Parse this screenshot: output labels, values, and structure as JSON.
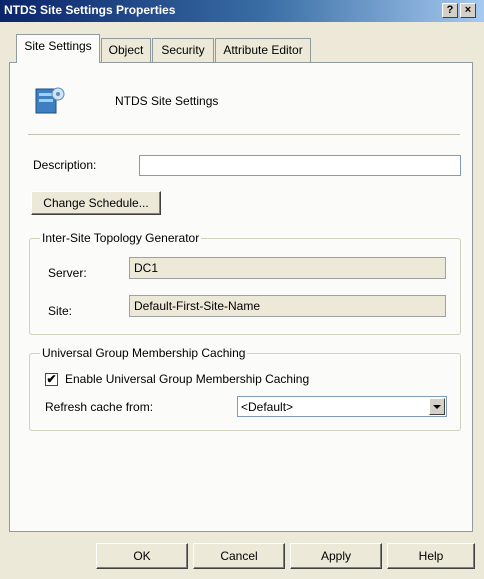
{
  "window": {
    "title": "NTDS Site Settings Properties",
    "help_label": "?",
    "close_label": "×"
  },
  "tabs": [
    {
      "label": "Site Settings",
      "active": true
    },
    {
      "label": "Object",
      "active": false
    },
    {
      "label": "Security",
      "active": false
    },
    {
      "label": "Attribute Editor",
      "active": false
    }
  ],
  "header": {
    "object_name": "NTDS Site Settings",
    "icon": "ntds-site-settings-icon"
  },
  "description": {
    "label": "Description:",
    "value": ""
  },
  "change_schedule": {
    "label": "Change Schedule..."
  },
  "istg": {
    "title": "Inter-Site Topology Generator",
    "server_label": "Server:",
    "server_value": "DC1",
    "site_label": "Site:",
    "site_value": "Default-First-Site-Name"
  },
  "ugmc": {
    "title": "Universal Group Membership Caching",
    "enable_label": "Enable Universal Group Membership Caching",
    "enable_checked": true,
    "refresh_label": "Refresh cache from:",
    "refresh_value": "<Default>"
  },
  "footer": {
    "ok": "OK",
    "cancel": "Cancel",
    "apply": "Apply",
    "help": "Help"
  }
}
